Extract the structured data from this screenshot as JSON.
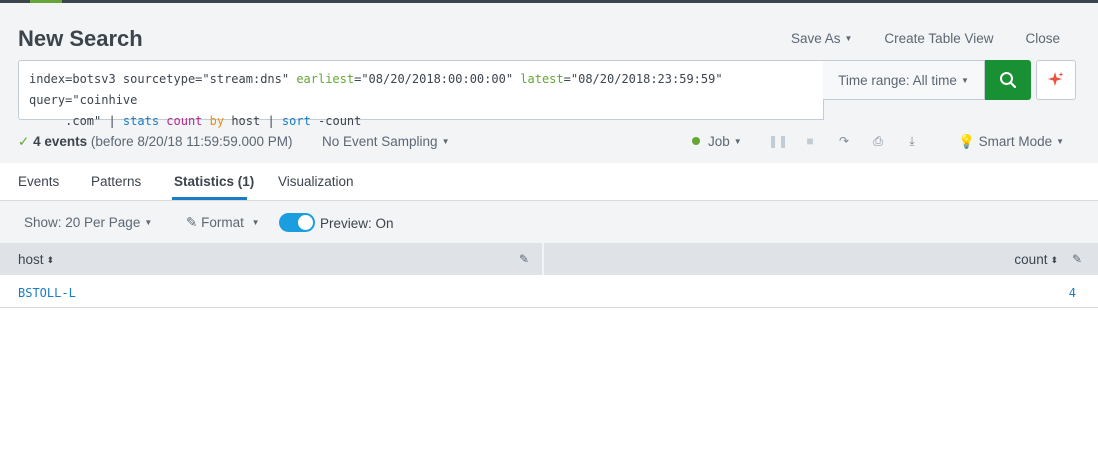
{
  "header": {
    "title": "New Search",
    "save_as": "Save As",
    "create_table_view": "Create Table View",
    "close": "Close"
  },
  "search": {
    "q1": "index=botsv3 sourcetype=\"stream:dns\" ",
    "q2": "earliest",
    "q3": "=\"08/20/2018:00:00:00\" ",
    "q4": "latest",
    "q5": "=\"08/20/2018:23:59:59\" query=\"coinhive\n     .com\" | ",
    "q6": "stats",
    "q7": " ",
    "q8": "count",
    "q9": " ",
    "q10": "by",
    "q11": " host | ",
    "q12": "sort",
    "q13": " -count",
    "time_range": "Time range: All time"
  },
  "status": {
    "events_count": "4 events",
    "events_detail": "(before 8/20/18 11:59:59.000 PM)",
    "sampling": "No Event Sampling",
    "job": "Job",
    "mode": "Smart Mode"
  },
  "tabs": [
    {
      "label": "Events"
    },
    {
      "label": "Patterns"
    },
    {
      "label": "Statistics (1)"
    },
    {
      "label": "Visualization"
    }
  ],
  "options": {
    "per_page": "Show: 20 Per Page",
    "format": "Format",
    "preview": "Preview: On"
  },
  "table": {
    "columns": [
      "host",
      "count"
    ],
    "rows": [
      {
        "host": "BSTOLL-L",
        "count": "4"
      }
    ]
  },
  "colors": {
    "accent_green": "#65a637",
    "search_button": "#1a9035",
    "link_blue": "#1a7cc4",
    "toggle_blue": "#1a9ee0"
  }
}
